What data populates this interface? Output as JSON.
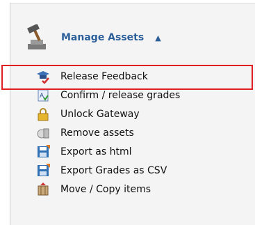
{
  "header": {
    "title": "Manage Assets",
    "caret": "▲",
    "icon": "hammer-icon"
  },
  "menu": {
    "items": [
      {
        "label": "Release Feedback",
        "icon": "graduation-cap-check-icon"
      },
      {
        "label": "Confirm / release grades",
        "icon": "grade-document-icon"
      },
      {
        "label": "Unlock Gateway",
        "icon": "padlock-icon"
      },
      {
        "label": "Remove assets",
        "icon": "remove-assets-icon"
      },
      {
        "label": "Export as html",
        "icon": "floppy-disk-icon"
      },
      {
        "label": "Export Grades as CSV",
        "icon": "floppy-disk-icon"
      },
      {
        "label": "Move / Copy items",
        "icon": "move-copy-icon"
      }
    ],
    "highlighted_item": "Release Feedback",
    "highlight_color": "#e02020",
    "title_color": "#2c5f9a"
  }
}
